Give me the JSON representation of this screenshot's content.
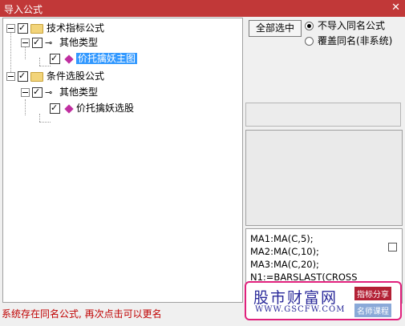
{
  "window": {
    "title": "导入公式",
    "close_glyph": "✕"
  },
  "tree": {
    "group1": {
      "label": "技术指标公式",
      "sub": {
        "label": "其他类型",
        "item": "价托擒妖主图"
      }
    },
    "group2": {
      "label": "条件选股公式",
      "sub": {
        "label": "其他类型",
        "item": "价托擒妖选股"
      }
    }
  },
  "controls": {
    "select_all": "全部选中",
    "radio_no_import": "不导入同名公式",
    "radio_overwrite": "覆盖同名(非系统)"
  },
  "code_lines": [
    "MA1:MA(C,5);",
    "MA2:MA(C,10);",
    "MA3:MA(C,20);",
    "N1:=BARSLAST(CROSS"
  ],
  "watermark": {
    "name": "股市财富网",
    "url": "WWW.GSCFW.COM",
    "tag1": "指标分享",
    "tag2": "名师课程"
  },
  "status": "系统存在同名公式, 再次点击可以更名",
  "colors": {
    "titlebar": "#c13838",
    "selection": "#3399ff",
    "status": "#c00000"
  }
}
